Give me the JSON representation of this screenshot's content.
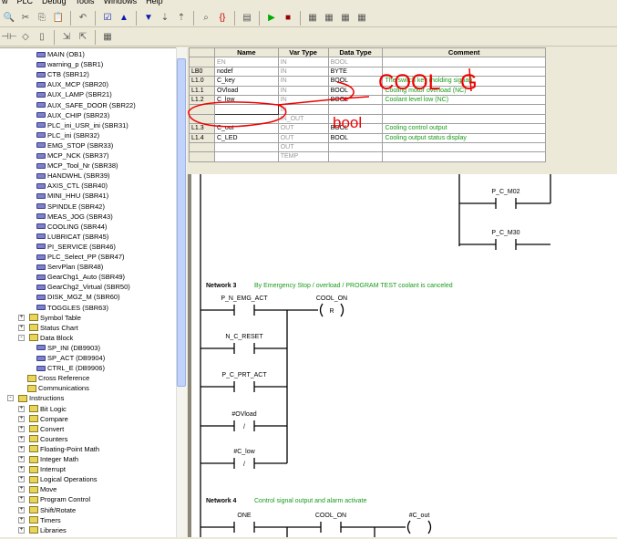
{
  "menu": [
    "w",
    "PLC",
    "Debug",
    "Tools",
    "Windows",
    "Help"
  ],
  "toolbar1_icons": [
    "print-preview-icon",
    "cut-icon",
    "copy-icon",
    "paste-icon",
    "undo-icon",
    "compile-icon",
    "upload-icon",
    "download-icon",
    "sort-ascending-icon",
    "sort-descending-icon",
    "find-icon",
    "options-icon",
    "window-icon",
    "run-icon",
    "stop-icon",
    "program-status-icon",
    "status-chart-icon",
    "trend-icon",
    "watch-icon"
  ],
  "toolbar2_icons": [
    "contact-icon",
    "coil-icon",
    "box-icon",
    "insert-network-icon",
    "delete-network-icon",
    "table-icon"
  ],
  "tree": {
    "pous": [
      "MAIN (OB1)",
      "warning_p (SBR1)",
      "CTB (SBR12)",
      "AUX_MCP (SBR20)",
      "AUX_LAMP (SBR21)",
      "AUX_SAFE_DOOR (SBR22)",
      "AUX_CHIP (SBR23)",
      "PLC_ini_USR_ini (SBR31)",
      "PLC_ini (SBR32)",
      "EMG_STOP (SBR33)",
      "MCP_NCK (SBR37)",
      "MCP_Tool_Nr (SBR38)",
      "HANDWHL (SBR39)",
      "AXIS_CTL (SBR40)",
      "MINI_HHU (SBR41)",
      "SPINDLE (SBR42)",
      "MEAS_JOG (SBR43)",
      "COOLING (SBR44)",
      "LUBRICAT (SBR45)",
      "PI_SERVICE (SBR46)",
      "PLC_Select_PP (SBR47)",
      "ServPlan (SBR48)",
      "GearChg1_Auto (SBR49)",
      "GearChg2_Virtual (SBR50)",
      "DISK_MGZ_M (SBR60)",
      "TOGGLES (SBR63)"
    ],
    "project": [
      "Symbol Table",
      "Status Chart",
      "Data Block"
    ],
    "data_blocks": [
      "SP_INI (DB9903)",
      "SP_ACT (DB9904)",
      "CTRL_E (DB9906)"
    ],
    "other": [
      "Cross Reference",
      "Communications"
    ],
    "instructions_label": "Instructions",
    "instructions": [
      "Bit Logic",
      "Compare",
      "Convert",
      "Counters",
      "Floating-Point Math",
      "Integer Math",
      "Interrupt",
      "Logical Operations",
      "Move",
      "Program Control",
      "Shift/Rotate",
      "Timers",
      "Libraries"
    ]
  },
  "var_table": {
    "headers": [
      "",
      "Name",
      "Var Type",
      "Data Type",
      "Comment"
    ],
    "rows": [
      [
        "",
        "EN",
        "IN",
        "BOOL",
        ""
      ],
      [
        "LB0",
        "nodef",
        "IN",
        "BYTE",
        ""
      ],
      [
        "L1.0",
        "C_key",
        "IN",
        "BOOL",
        "The switch key (holding signal)"
      ],
      [
        "L1.1",
        "OVload",
        "IN",
        "BOOL",
        "Cooling motor overload (NC)"
      ],
      [
        "L1.2",
        "C_low",
        "IN",
        "BOOL",
        "Coolant level low (NC)"
      ],
      [
        "",
        "",
        "IN",
        "",
        ""
      ],
      [
        "",
        "",
        "IN_OUT",
        "",
        ""
      ],
      [
        "L1.3",
        "C_out",
        "OUT",
        "BOOL",
        "Cooling control output"
      ],
      [
        "L1.4",
        "C_LED",
        "OUT",
        "BOOL",
        "Cooling output status display"
      ],
      [
        "",
        "",
        "OUT",
        "",
        ""
      ],
      [
        "",
        "",
        "TEMP",
        "",
        ""
      ]
    ]
  },
  "annotations": {
    "color": "#e00000",
    "texts": [
      "COOL",
      "G",
      "bool"
    ]
  },
  "ladder": {
    "net2": {
      "contacts": [
        "P_C_M02",
        "P_C_M30"
      ]
    },
    "net3": {
      "label": "Network 3",
      "comment": "By Emergency Stop / overload / PROGRAM TEST coolant is canceled",
      "contacts": [
        "P_N_EMG_ACT",
        "N_C_RESET",
        "P_C_PRT_ACT",
        "#OVload",
        "#C_low"
      ],
      "negated": [
        false,
        false,
        false,
        true,
        true
      ],
      "coil": "COOL_ON",
      "coil_type": "R"
    },
    "net4": {
      "label": "Network 4",
      "comment": "Control signal output and alarm activate",
      "contacts": [
        "ONE",
        "COOL_ON"
      ],
      "coil": "#C_out"
    }
  }
}
